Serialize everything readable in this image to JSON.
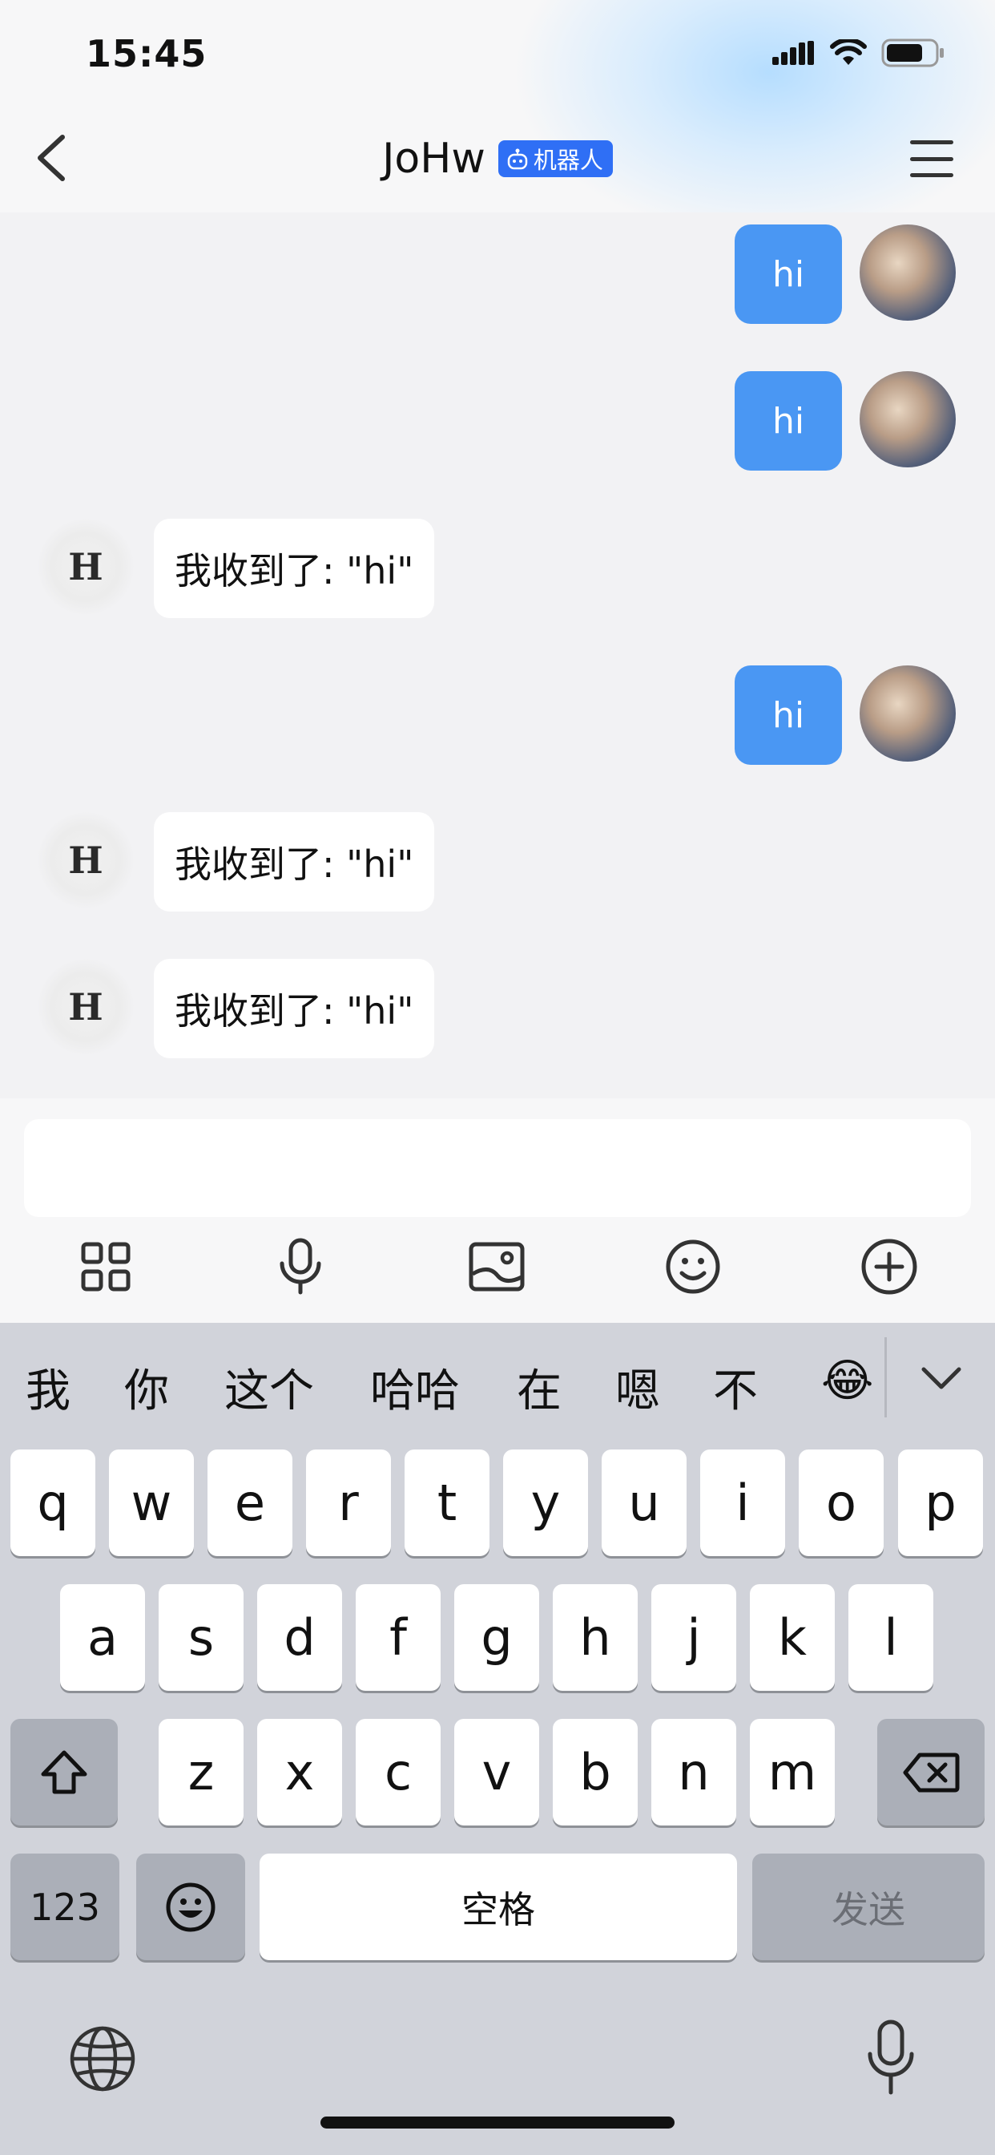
{
  "status_bar": {
    "time": "15:45"
  },
  "header": {
    "title": "JoHw",
    "badge": "机器人"
  },
  "messages": [
    {
      "sender": "user",
      "text": "hi"
    },
    {
      "sender": "user",
      "text": "hi"
    },
    {
      "sender": "bot",
      "avatar_text": "H",
      "text": "我收到了: \"hi\""
    },
    {
      "sender": "user",
      "text": "hi"
    },
    {
      "sender": "bot",
      "avatar_text": "H",
      "text": "我收到了: \"hi\""
    },
    {
      "sender": "bot",
      "avatar_text": "H",
      "text": "我收到了: \"hi\""
    }
  ],
  "input": {
    "value": ""
  },
  "toolbar_icons": [
    "grid-icon",
    "microphone-icon",
    "image-icon",
    "emoji-icon",
    "plus-circle-icon"
  ],
  "keyboard": {
    "candidates": [
      "我",
      "你",
      "这个",
      "哈哈",
      "在",
      "嗯",
      "不",
      "😂"
    ],
    "row1": [
      "q",
      "w",
      "e",
      "r",
      "t",
      "y",
      "u",
      "i",
      "o",
      "p"
    ],
    "row2": [
      "a",
      "s",
      "d",
      "f",
      "g",
      "h",
      "j",
      "k",
      "l"
    ],
    "row3": [
      "z",
      "x",
      "c",
      "v",
      "b",
      "n",
      "m"
    ],
    "numbers_label": "123",
    "space_label": "空格",
    "send_label": "发送"
  },
  "colors": {
    "accent": "#4a97f3",
    "badge": "#2f6ff5"
  }
}
